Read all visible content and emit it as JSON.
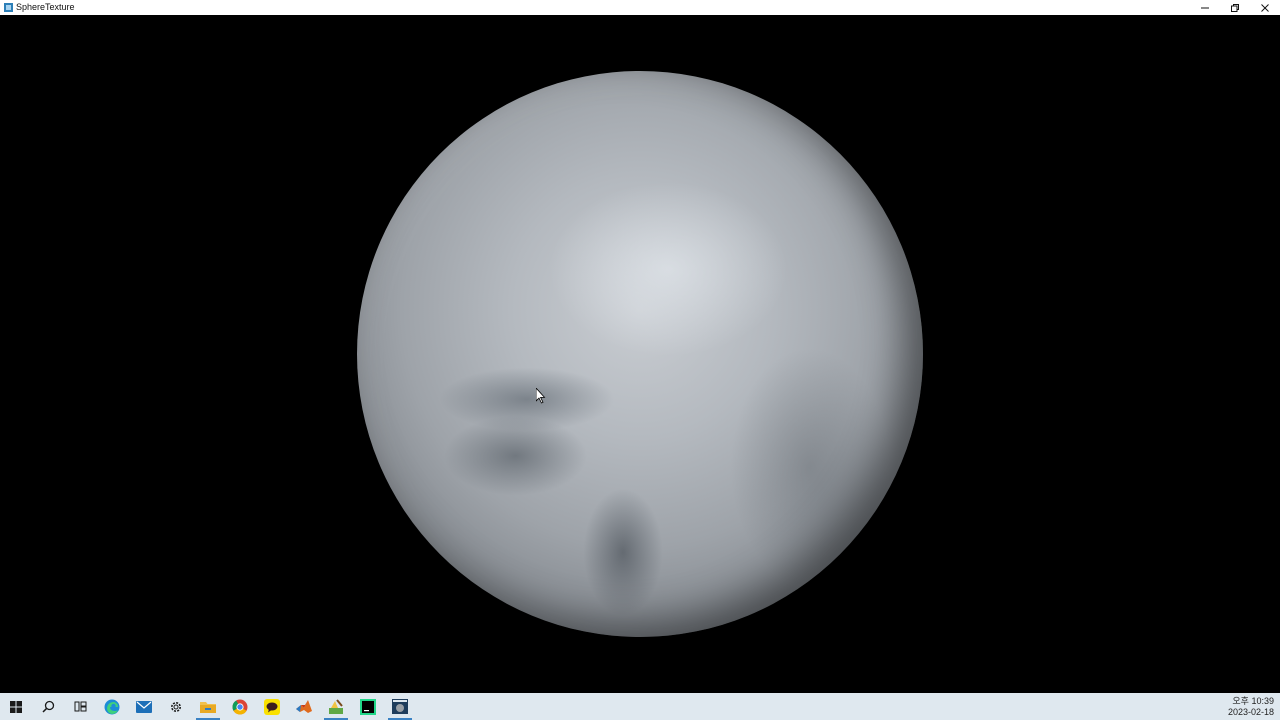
{
  "window": {
    "title": "SphereTexture",
    "icon": "opengl-app-icon",
    "controls": [
      "minimize-icon",
      "restore-icon",
      "close-icon"
    ]
  },
  "viewport": {
    "background": "#000000",
    "content": "textured-sphere",
    "sphere_colors": [
      "#c9cdd2",
      "#9ea3a9",
      "#5c6066"
    ]
  },
  "taskbar": {
    "background": "#dfe8ef",
    "apps": [
      {
        "icon": "windows-start-icon"
      },
      {
        "icon": "search-icon"
      },
      {
        "icon": "task-view-icon"
      },
      {
        "icon": "edge-browser-icon"
      },
      {
        "icon": "mail-icon"
      },
      {
        "icon": "settings-gear-icon"
      },
      {
        "icon": "file-explorer-icon"
      },
      {
        "icon": "chrome-icon"
      },
      {
        "icon": "kakaotalk-icon"
      },
      {
        "icon": "matlab-icon"
      },
      {
        "icon": "paint-icon"
      },
      {
        "icon": "pycharm-icon"
      },
      {
        "icon": "opengl-app-icon"
      }
    ],
    "clock": {
      "time": "오후 10:39",
      "date": "2023-02-18"
    }
  }
}
